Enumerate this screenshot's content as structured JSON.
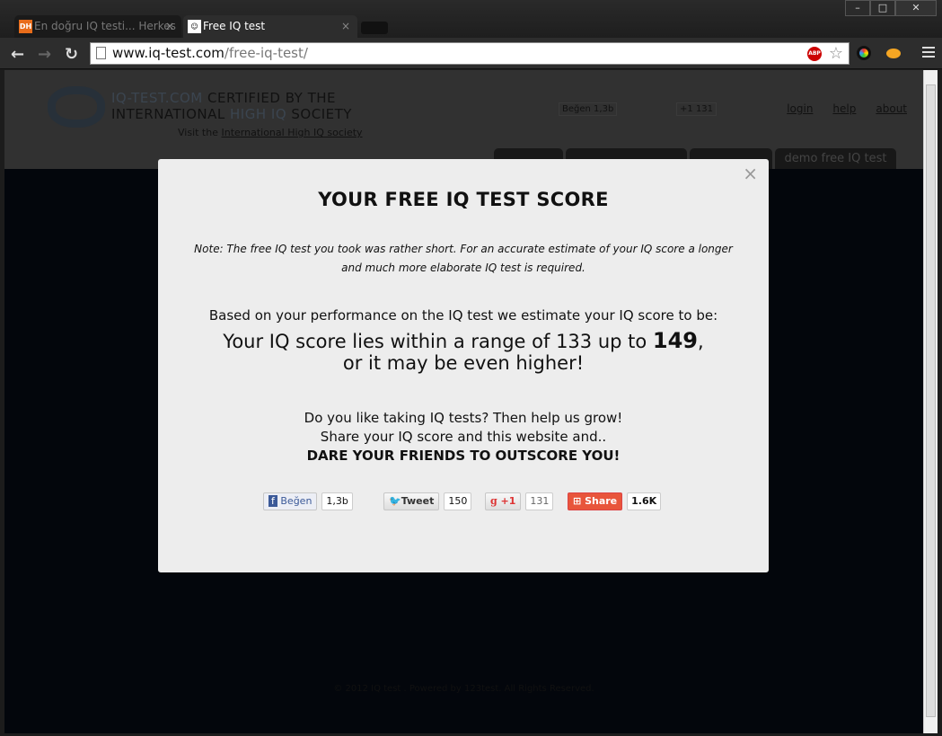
{
  "browser": {
    "tabs": [
      {
        "label": "En doğru IQ testi... Herkes",
        "favicon": "DH",
        "active": false
      },
      {
        "label": "Free IQ test",
        "active": true
      }
    ],
    "url_host": "www.iq-test.com",
    "url_path": "/free-iq-test/",
    "window_controls": {
      "minimize": "–",
      "maximize": "□",
      "close": "✕"
    }
  },
  "site": {
    "brand_line1_dim": "IQ-TEST.COM",
    "brand_line1": "CERTIFIED  BY THE",
    "brand_line2a": "INTERNATIONAL ",
    "brand_line2_dim": "HIGH IQ",
    "brand_line2b": " SOCIETY",
    "visit_prefix": "Visit the ",
    "visit_link": "International High IQ society",
    "fb_label": "Beğen",
    "fb_count": "1,3b",
    "gplus_label": "+1",
    "gplus_count": "131",
    "links": [
      "login",
      "help",
      "about"
    ],
    "nav_active": "demo free IQ test",
    "footer": "© 2012 IQ test . Powered by 123test. All Rights Reserved."
  },
  "modal": {
    "title": "YOUR FREE IQ TEST SCORE",
    "note": "Note: The free IQ test you took was rather short. For an accurate estimate of your IQ score a longer and much more elaborate IQ test is required.",
    "based": "Based on your performance on the IQ test we estimate your IQ score to be:",
    "range_prefix": "Your IQ score lies within a range of 133 up to ",
    "range_high": "149",
    "range_suffix": ",",
    "range_line2": "or it may be even higher!",
    "share1": "Do you like taking IQ tests? Then help us grow!",
    "share2": "Share your IQ score and this website and..",
    "dare": "DARE YOUR FRIENDS TO OUTSCORE YOU!",
    "social": {
      "fb_label": "Beğen",
      "fb_count": "1,3b",
      "tweet_label": "Tweet",
      "tweet_count": "150",
      "gplus_label": "+1",
      "gplus_count": "131",
      "share_label": "Share",
      "share_count": "1.6K"
    },
    "close": "×"
  },
  "colors": {
    "share": "#e8553b",
    "modal_bg": "#ededed",
    "overlay": "#03060c"
  }
}
